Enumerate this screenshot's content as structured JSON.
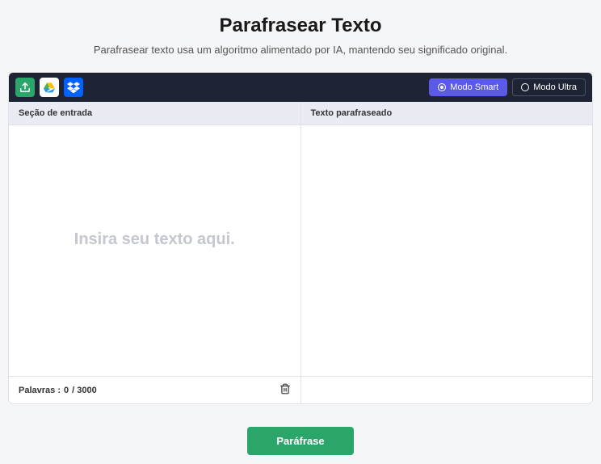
{
  "header": {
    "title": "Parafrasear Texto",
    "subtitle": "Parafrasear texto usa um algoritmo alimentado por IA, mantendo seu significado original."
  },
  "toolbar": {
    "modes": {
      "smart_label": "Modo Smart",
      "ultra_label": "Modo Ultra"
    }
  },
  "panels": {
    "input_header": "Seção de entrada",
    "output_header": "Texto parafraseado",
    "input_placeholder": "Insira seu texto aqui.",
    "input_value": ""
  },
  "footer": {
    "words_label": "Palavras :",
    "words_current": "0",
    "words_max": "/ 3000"
  },
  "actions": {
    "submit_label": "Paráfrase"
  }
}
